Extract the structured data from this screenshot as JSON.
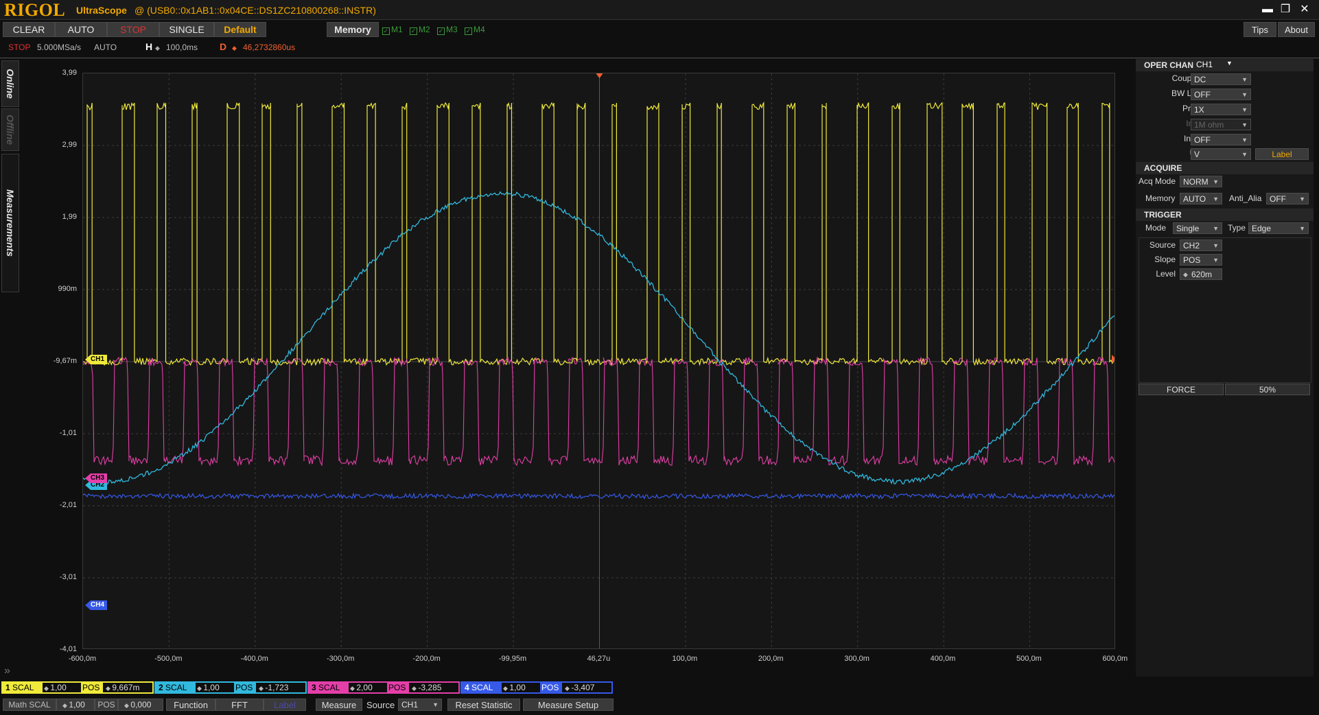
{
  "titlebar": {
    "logo": "RIGOL",
    "app": "UltraScope",
    "device": "@ (USB0::0x1AB1::0x04CE::DS1ZC210800268::INSTR)",
    "minimize": "▬",
    "restore": "❐",
    "close": "✕"
  },
  "toolbar": {
    "clear": "CLEAR",
    "auto": "AUTO",
    "stop": "STOP",
    "single": "SINGLE",
    "default": "Default",
    "memory": "Memory",
    "m1": "M1",
    "m2": "M2",
    "m3": "M3",
    "m4": "M4",
    "tips": "Tips",
    "about": "About"
  },
  "status": {
    "state": "STOP",
    "sample_rate": "5.000MSa/s",
    "mode": "AUTO",
    "h_label": "H",
    "h_value": "100,0ms",
    "d_label": "D",
    "d_value": "46,2732860us"
  },
  "side_tabs": {
    "online": "Online",
    "offline": "Offline",
    "measurements": "Measurements"
  },
  "plot": {
    "y_labels": [
      "3,99",
      "2,99",
      "1,99",
      "990m",
      "-9,67m",
      "-1,01",
      "-2,01",
      "-3,01",
      "-4,01"
    ],
    "x_labels": [
      "-600,0m",
      "-500,0m",
      "-400,0m",
      "-300,0m",
      "-200,0m",
      "-99,95m",
      "46,27u",
      "100,0m",
      "200,0m",
      "300,0m",
      "400,0m",
      "500,0m",
      "600,0m"
    ],
    "markers": {
      "ch1": "CH1",
      "ch2": "CH2",
      "ch3": "CH3",
      "ch4": "CH4"
    },
    "colors": {
      "ch1": "#f0ea3a",
      "ch2": "#31b9de",
      "ch3": "#e43fa8",
      "ch4": "#3659e8",
      "grid": "#3c3c3c"
    }
  },
  "panel": {
    "oper_chan_label": "OPER CHAN",
    "oper_chan_value": "CH1",
    "coupling_label": "Coupling",
    "coupling_value": "DC",
    "bw_label": "BW Limit",
    "bw_value": "OFF",
    "probe_label": "Probe",
    "probe_value": "1X",
    "input_label": "Input",
    "input_value": "1M ohm",
    "invert_label": "Invert",
    "invert_value": "OFF",
    "unit_label": "Unit",
    "unit_value": "V",
    "label_button": "Label",
    "acquire_head": "ACQUIRE",
    "acq_mode_label": "Acq Mode",
    "acq_mode_value": "NORM",
    "memory_label": "Memory",
    "memory_value": "AUTO",
    "anti_alias_label": "Anti_Alia",
    "anti_alias_value": "OFF",
    "trigger_head": "TRIGGER",
    "trig_mode_label": "Mode",
    "trig_mode_value": "Single",
    "trig_type_label": "Type",
    "trig_type_value": "Edge",
    "source_label": "Source",
    "source_value": "CH2",
    "slope_label": "Slope",
    "slope_value": "POS",
    "level_label": "Level",
    "level_value": "620m",
    "force_button": "FORCE",
    "fifty_button": "50%"
  },
  "channels": [
    {
      "num": "1",
      "scal_label": "SCAL",
      "scal": "1,00",
      "pos_label": "POS",
      "pos": "9,667m"
    },
    {
      "num": "2",
      "scal_label": "SCAL",
      "scal": "1,00",
      "pos_label": "POS",
      "pos": "-1,723"
    },
    {
      "num": "3",
      "scal_label": "SCAL",
      "scal": "2,00",
      "pos_label": "POS",
      "pos": "-3,285"
    },
    {
      "num": "4",
      "scal_label": "SCAL",
      "scal": "1,00",
      "pos_label": "POS",
      "pos": "-3,407"
    }
  ],
  "bottom": {
    "math_scal_label": "Math SCAL",
    "math_scal": "1,00",
    "math_pos_label": "POS",
    "math_pos": "0,000",
    "function": "Function",
    "fft": "FFT",
    "label": "Label",
    "measure": "Measure",
    "source_label": "Source",
    "source_value": "CH1",
    "reset_statistic": "Reset  Statistic",
    "measure_setup": "Measure Setup"
  }
}
